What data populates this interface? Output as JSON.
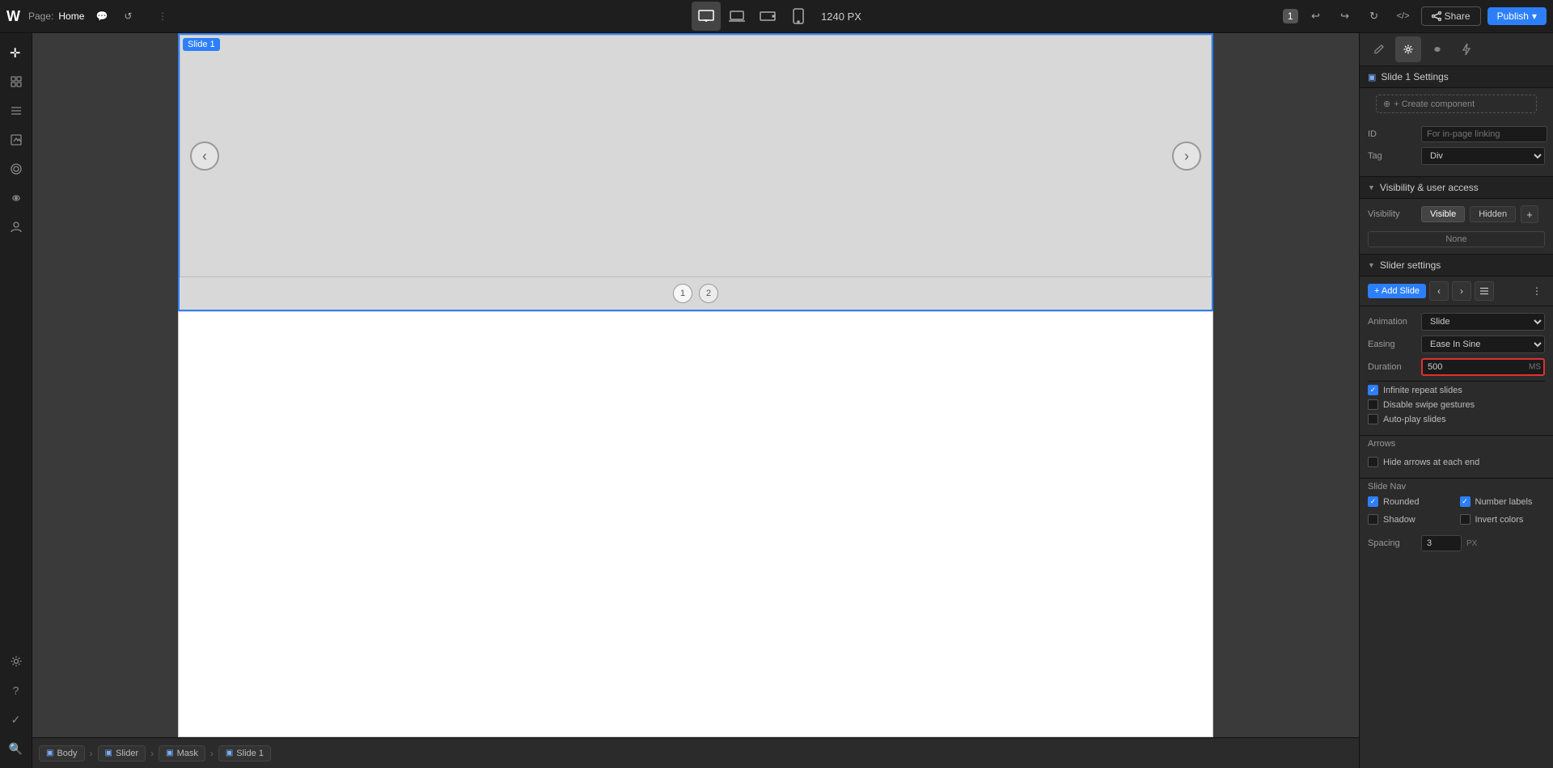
{
  "topbar": {
    "logo": "W",
    "page_label": "Page:",
    "page_name": "Home",
    "dots_icon": "⋮",
    "px_value": "1240 PX",
    "devices": [
      {
        "label": "desktop",
        "icon": "🖥",
        "active": true
      },
      {
        "label": "laptop",
        "icon": "💻",
        "active": false
      },
      {
        "label": "tablet-landscape",
        "icon": "▭",
        "active": false
      },
      {
        "label": "tablet-portrait",
        "icon": "📱",
        "active": false
      }
    ],
    "badge_number": "1",
    "undo_icon": "↩",
    "redo_icon": "↪",
    "refresh_icon": "↻",
    "code_icon": "</>",
    "share_label": "Share",
    "publish_label": "Publish",
    "more_icon": "▾"
  },
  "left_sidebar": {
    "items": [
      {
        "name": "add-element",
        "icon": "✛"
      },
      {
        "name": "pages",
        "icon": "⊞"
      },
      {
        "name": "layers",
        "icon": "≡"
      },
      {
        "name": "assets",
        "icon": "▣"
      },
      {
        "name": "components",
        "icon": "⊙"
      },
      {
        "name": "interactions",
        "icon": "⟳"
      },
      {
        "name": "users",
        "icon": "👤"
      },
      {
        "name": "settings",
        "icon": "⚙"
      },
      {
        "name": "bottom-help",
        "icon": "?"
      },
      {
        "name": "tasks",
        "icon": "✓"
      },
      {
        "name": "search",
        "icon": "🔍"
      }
    ]
  },
  "canvas": {
    "slide_label": "Slide 1",
    "dot1": "1",
    "dot2": "2"
  },
  "breadcrumb": {
    "items": [
      {
        "label": "Body",
        "icon": "▣"
      },
      {
        "label": "Slider",
        "icon": "▣"
      },
      {
        "label": "Mask",
        "icon": "▣"
      },
      {
        "label": "Slide 1",
        "icon": "▣"
      }
    ]
  },
  "right_panel": {
    "tabs": [
      {
        "name": "brush",
        "icon": "🖌",
        "active": false
      },
      {
        "name": "settings",
        "icon": "⚙",
        "active": true
      },
      {
        "name": "interactions",
        "icon": "◈",
        "active": false
      },
      {
        "name": "lightning",
        "icon": "⚡",
        "active": false
      }
    ],
    "header": {
      "icon": "▣",
      "title": "Slide 1 Settings"
    },
    "create_component_label": "+ Create component",
    "id_label": "ID",
    "id_placeholder": "For in-page linking",
    "tag_label": "Tag",
    "tag_value": "Div",
    "visibility_section": {
      "title": "Visibility & user access",
      "visibility_label": "Visibility",
      "visible_btn": "Visible",
      "hidden_btn": "Hidden",
      "add_icon": "+",
      "none_btn": "None"
    },
    "slider_settings": {
      "title": "Slider settings",
      "add_slide_btn": "+ Add Slide",
      "animation_label": "Animation",
      "animation_value": "Slide",
      "easing_label": "Easing",
      "easing_value": "Ease In Sine",
      "duration_label": "Duration",
      "duration_value": "500",
      "duration_suffix": "MS",
      "infinite_repeat_label": "Infinite repeat slides",
      "disable_swipe_label": "Disable swipe gestures",
      "autoplay_label": "Auto-play slides",
      "arrows_section": "Arrows",
      "hide_arrows_label": "Hide arrows at each end",
      "slide_nav_section": "Slide Nav",
      "rounded_label": "Rounded",
      "shadow_label": "Shadow",
      "number_labels_label": "Number labels",
      "invert_colors_label": "Invert colors",
      "spacing_label": "Spacing",
      "spacing_value": "3"
    }
  }
}
